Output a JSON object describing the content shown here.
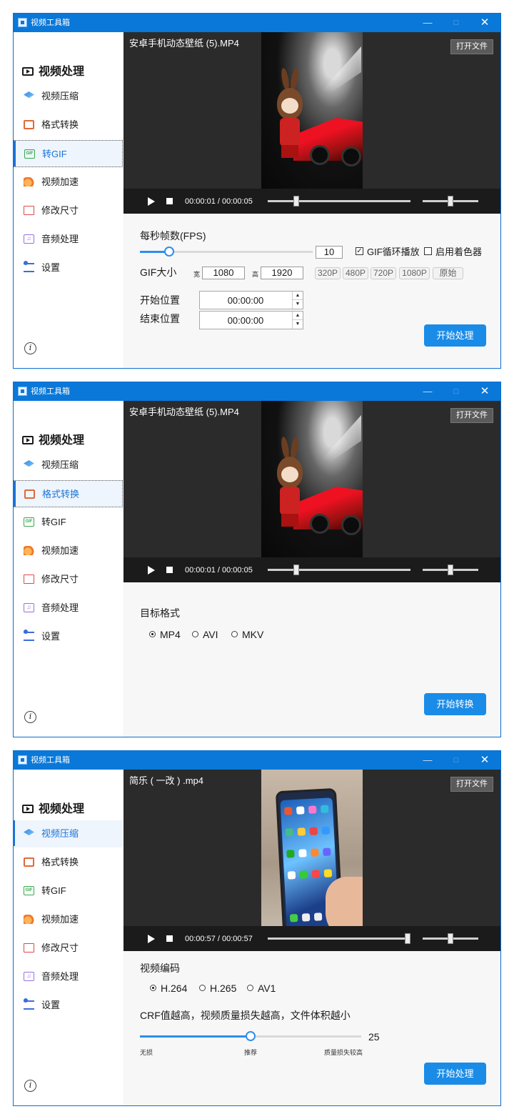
{
  "app_title": "视频工具箱",
  "window_controls": {
    "minimize": "—",
    "maximize": "□",
    "close": "✕"
  },
  "sidebar": {
    "heading": "视频处理",
    "items": [
      {
        "label": "视频压缩",
        "icon": "layers-icon"
      },
      {
        "label": "格式转换",
        "icon": "convert-icon"
      },
      {
        "label": "转GIF",
        "icon": "gif-icon"
      },
      {
        "label": "视频加速",
        "icon": "speed-icon"
      },
      {
        "label": "修改尺寸",
        "icon": "resize-icon"
      },
      {
        "label": "音频处理",
        "icon": "music-icon"
      },
      {
        "label": "设置",
        "icon": "settings-icon"
      }
    ],
    "info_glyph": "i"
  },
  "player": {
    "open_file": "打开文件",
    "video_name_1": "安卓手机动态壁纸 (5).MP4",
    "video_name_3": "简乐 ( 一改 ) .mp4",
    "time_1": "00:00:01 / 00:00:05",
    "time_3": "00:00:57 / 00:00:57",
    "progress_1": 0.2,
    "progress_3": 1.0,
    "volume": 0.5
  },
  "window1": {
    "active_item": "转GIF",
    "fps_label": "每秒帧数(FPS)",
    "fps_value": "10",
    "fps_fraction": 0.17,
    "gif_loop_label": "GIF循环播放",
    "gif_loop_checked": true,
    "gif_loop_mark": "✓",
    "colorizer_label": "启用着色器",
    "colorizer_checked": false,
    "size_label": "GIF大小",
    "width_label": "宽",
    "width_value": "1080",
    "height_label": "高",
    "height_value": "1920",
    "presets": [
      "320P",
      "480P",
      "720P",
      "1080P",
      "原始"
    ],
    "start_label": "开始位置",
    "start_value": "00:00:00",
    "end_label": "结束位置",
    "end_value": "00:00:00",
    "spin_up": "▲",
    "spin_down": "▼",
    "action": "开始处理"
  },
  "window2": {
    "active_item": "格式转换",
    "target_label": "目标格式",
    "formats": [
      "MP4",
      "AVI",
      "MKV"
    ],
    "selected": "MP4",
    "action": "开始转换"
  },
  "window3": {
    "active_item": "视频压缩",
    "codec_label": "视频编码",
    "codecs": [
      "H.264",
      "H.265",
      "AV1"
    ],
    "selected": "H.264",
    "crf_desc": "CRF值越高，视频质量损失越高，文件体积越小",
    "crf_value": "25",
    "crf_fraction": 0.5,
    "scale_labels": [
      "无损",
      "推荐",
      "质量损失较高"
    ],
    "action": "开始处理"
  },
  "colors": {
    "title_bar": "#0a78d8",
    "accent": "#1a8ce8",
    "player_bg": "#2b2b2b"
  }
}
